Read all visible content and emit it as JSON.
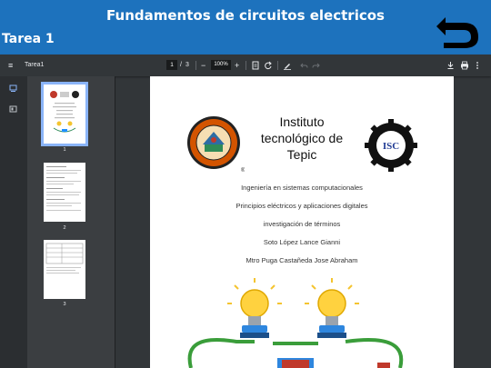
{
  "header": {
    "title": "Fundamentos de circuitos electricos",
    "task": "Tarea 1",
    "back_icon": "back-arrow-icon"
  },
  "toolbar": {
    "doc_name": "Tarea1",
    "page_current": "1",
    "page_sep": "/",
    "page_total": "3",
    "zoom": "100%",
    "zoom_out": "−",
    "zoom_in": "+"
  },
  "thumbnails": [
    {
      "label": "1"
    },
    {
      "label": "2"
    },
    {
      "label": "3"
    }
  ],
  "document": {
    "institute": "Instituto tecnológico de Tepic",
    "lines": [
      "Ingeniería en sistemas computacionales",
      "Principios eléctricos y aplicaciones digitales",
      "investigación de términos",
      "Soto López Lance Gianni",
      "Mtro Puga Castañeda Jose Abraham"
    ]
  },
  "colors": {
    "header_bg": "#1d72bd",
    "toolbar_bg": "#323639",
    "selection": "#8ab4f8"
  }
}
